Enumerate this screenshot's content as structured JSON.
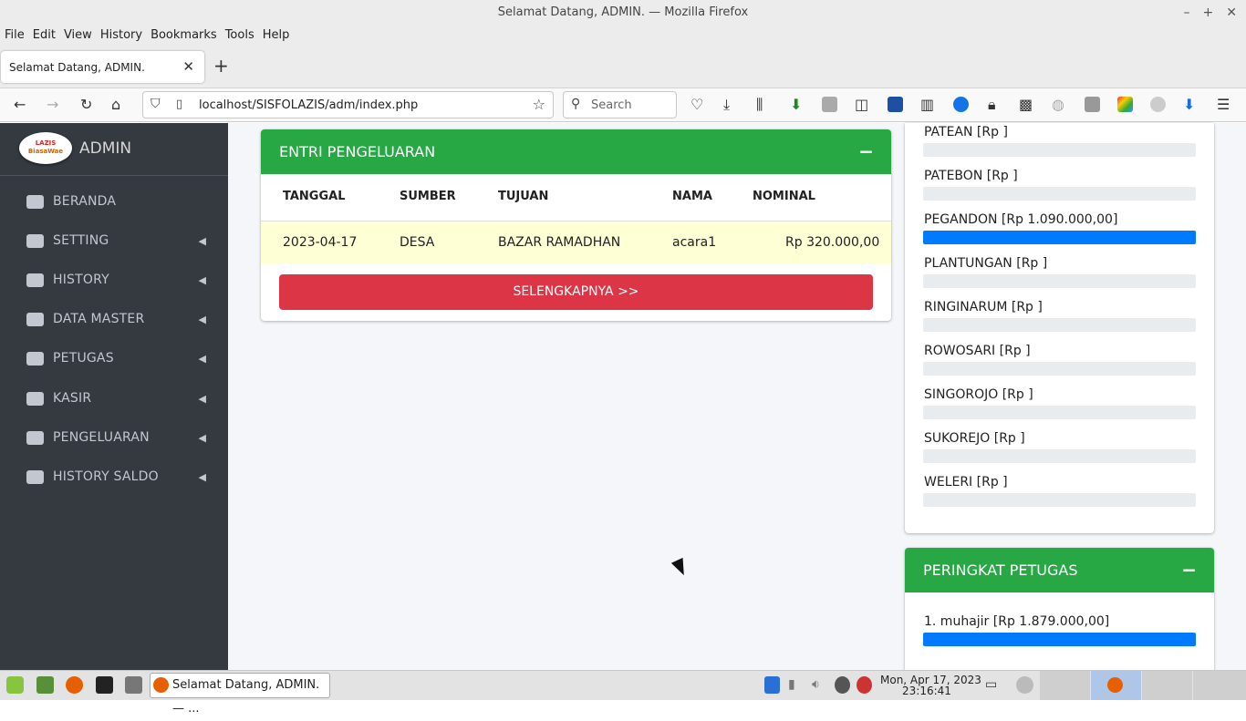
{
  "window": {
    "title": "Selamat Datang, ADMIN. — Mozilla Firefox"
  },
  "menu": [
    "File",
    "Edit",
    "View",
    "History",
    "Bookmarks",
    "Tools",
    "Help"
  ],
  "tab": {
    "title": "Selamat Datang, ADMIN."
  },
  "address": {
    "url": "localhost/SISFOLAZIS/adm/index.php"
  },
  "search": {
    "placeholder": "Search"
  },
  "sidebar": {
    "brand": "ADMIN",
    "logo_text_top": "LAZIS",
    "logo_text_bottom": "BiasaWae",
    "items": [
      {
        "label": "BERANDA",
        "icon": "home-icon"
      },
      {
        "label": "SETTING",
        "icon": "dashboard-icon"
      },
      {
        "label": "HISTORY",
        "icon": "list-icon"
      },
      {
        "label": "DATA MASTER",
        "icon": "database-icon"
      },
      {
        "label": "PETUGAS",
        "icon": "users-icon"
      },
      {
        "label": "KASIR",
        "icon": "money-icon"
      },
      {
        "label": "PENGELUARAN",
        "icon": "sign-out-icon"
      },
      {
        "label": "HISTORY SALDO",
        "icon": "briefcase-icon"
      }
    ]
  },
  "expense_card": {
    "title": "ENTRI PENGELUARAN",
    "collapse": "−",
    "columns": [
      "TANGGAL",
      "SUMBER",
      "TUJUAN",
      "NAMA",
      "NOMINAL"
    ],
    "rows": [
      [
        "2023-04-17",
        "DESA",
        "BAZAR RAMADHAN",
        "acara1",
        "Rp 320.000,00"
      ]
    ],
    "more_button": "SELENGKAPNYA >>"
  },
  "village_card": {
    "items": [
      {
        "label": "PATEAN [Rp ]",
        "fraction": 0
      },
      {
        "label": "PATEBON [Rp ]",
        "fraction": 0
      },
      {
        "label": "PEGANDON [Rp 1.090.000,00]",
        "fraction": 1
      },
      {
        "label": "PLANTUNGAN [Rp ]",
        "fraction": 0
      },
      {
        "label": "RINGINARUM [Rp ]",
        "fraction": 0
      },
      {
        "label": "ROWOSARI [Rp ]",
        "fraction": 0
      },
      {
        "label": "SINGOROJO [Rp ]",
        "fraction": 0
      },
      {
        "label": "SUKOREJO [Rp ]",
        "fraction": 0
      },
      {
        "label": "WELERI [Rp ]",
        "fraction": 0
      }
    ]
  },
  "officer_card": {
    "title": "PERINGKAT PETUGAS",
    "collapse": "−",
    "items": [
      {
        "label": "1. muhajir [Rp 1.879.000,00]",
        "fraction": 1
      }
    ]
  },
  "taskbar": {
    "app_label": "Selamat Datang, ADMIN. — ...",
    "clock_date": "Mon, Apr 17, 2023",
    "clock_time": "23:16:41"
  },
  "colors": {
    "green": "#28a745",
    "red": "#dc3545",
    "blue": "#007bff",
    "sidebar": "#343a40"
  }
}
